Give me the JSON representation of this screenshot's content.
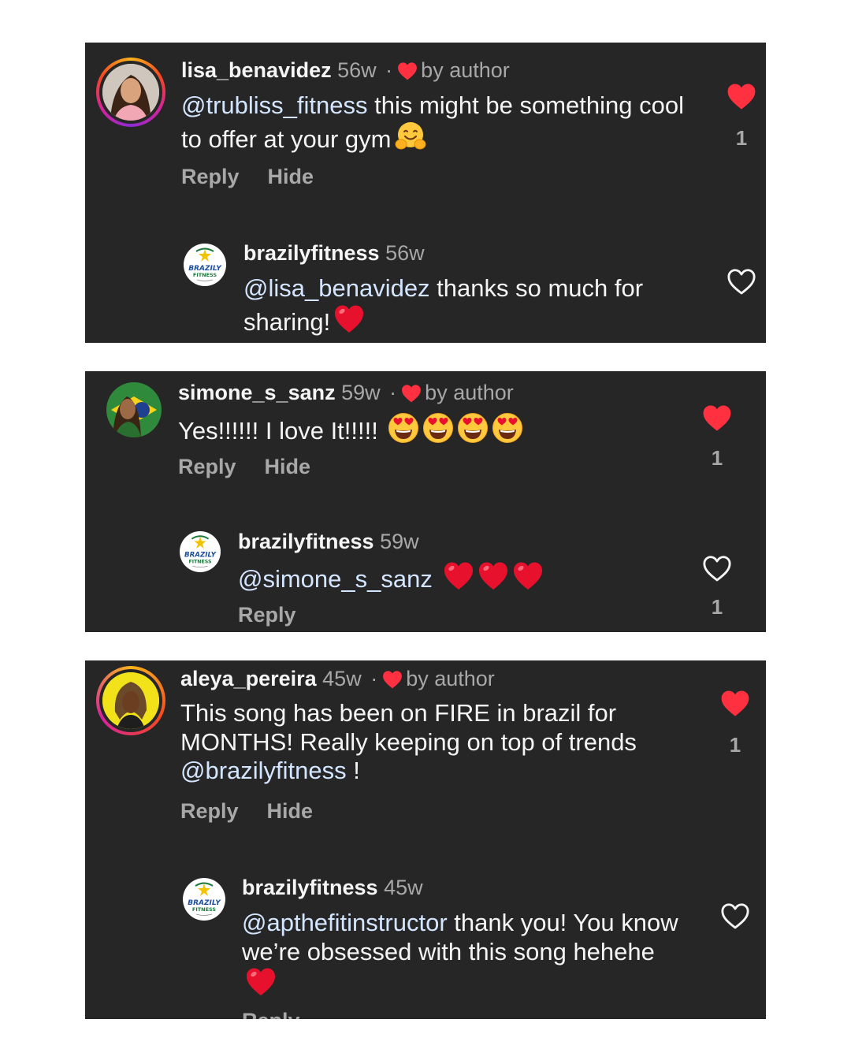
{
  "by_author_label": "by author",
  "reply_label": "Reply",
  "hide_label": "Hide",
  "threads": [
    {
      "comment": {
        "username": "lisa_benavidez",
        "time": "56w",
        "mention": "@trubliss_fitness",
        "text": " this might be something cool to offer at your gym",
        "emojis": [
          "hugging-face"
        ],
        "liked": true,
        "likes": "1"
      },
      "reply": {
        "username": "brazilyfitness",
        "time": "56w",
        "mention": "@lisa_benavidez",
        "text": " thanks so much for sharing!",
        "emojis": [
          "red-heart"
        ],
        "liked": false,
        "likes": ""
      }
    },
    {
      "comment": {
        "username": "simone_s_sanz",
        "time": "59w",
        "mention": "",
        "text": "Yes!!!!!! I love It!!!!!",
        "emojis": [
          "heart-eyes",
          "heart-eyes",
          "heart-eyes",
          "heart-eyes"
        ],
        "liked": true,
        "likes": "1"
      },
      "reply": {
        "username": "brazilyfitness",
        "time": "59w",
        "mention": "@simone_s_sanz",
        "text": "",
        "emojis": [
          "red-heart",
          "red-heart",
          "red-heart"
        ],
        "liked": false,
        "likes": "1"
      }
    },
    {
      "comment": {
        "username": "aleya_pereira",
        "time": "45w",
        "mention": "",
        "text": "This song has been on FIRE in brazil for MONTHS! Really keeping on top of trends ",
        "mention_end": "@brazilyfitness",
        "text_end": " !",
        "emojis": [],
        "liked": true,
        "likes": "1"
      },
      "reply": {
        "username": "brazilyfitness",
        "time": "45w",
        "mention": "@apthefitinstructor",
        "text": " thank you! You know we’re obsessed with this song hehehe",
        "emojis": [
          "red-heart"
        ],
        "liked": false,
        "likes": ""
      }
    }
  ],
  "logo": {
    "line1": "BRAZILY",
    "line2": "FITNESS"
  },
  "colors": {
    "panel": "#262626",
    "like_red": "#ff3040",
    "mention": "#d4e6ff",
    "text": "#f5f5f5",
    "muted": "#a8a8a8"
  }
}
